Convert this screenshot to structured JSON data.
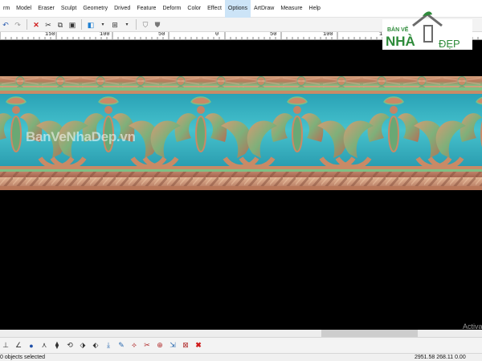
{
  "menu": {
    "items": [
      "rm",
      "Model",
      "Eraser",
      "Sculpt",
      "Geometry",
      "Drived",
      "Feature",
      "Deform",
      "Color",
      "Effect",
      "Options",
      "ArtDraw",
      "Measure",
      "Help"
    ]
  },
  "ruler": {
    "labels": [
      "150",
      "100",
      "50",
      "0",
      "50",
      "100",
      "150"
    ]
  },
  "viewport": {
    "watermark": "BanVeNhaDep.vn"
  },
  "logo": {
    "top": "BẢN VẼ",
    "main": "NHÀ",
    "dep": "ĐẸP"
  },
  "activate_hint": "Activa",
  "status": {
    "left": "0 objects selected",
    "coordinates": "2951.58 268.11 0.00"
  },
  "colors": {
    "viewport_bg": "#000000",
    "relief_teal": "#3fb7c4",
    "relief_copper": "#c98a66",
    "relief_green": "#5fae6a",
    "logo_green": "#2e8b3a",
    "menu_highlight": "#cce4f7"
  }
}
